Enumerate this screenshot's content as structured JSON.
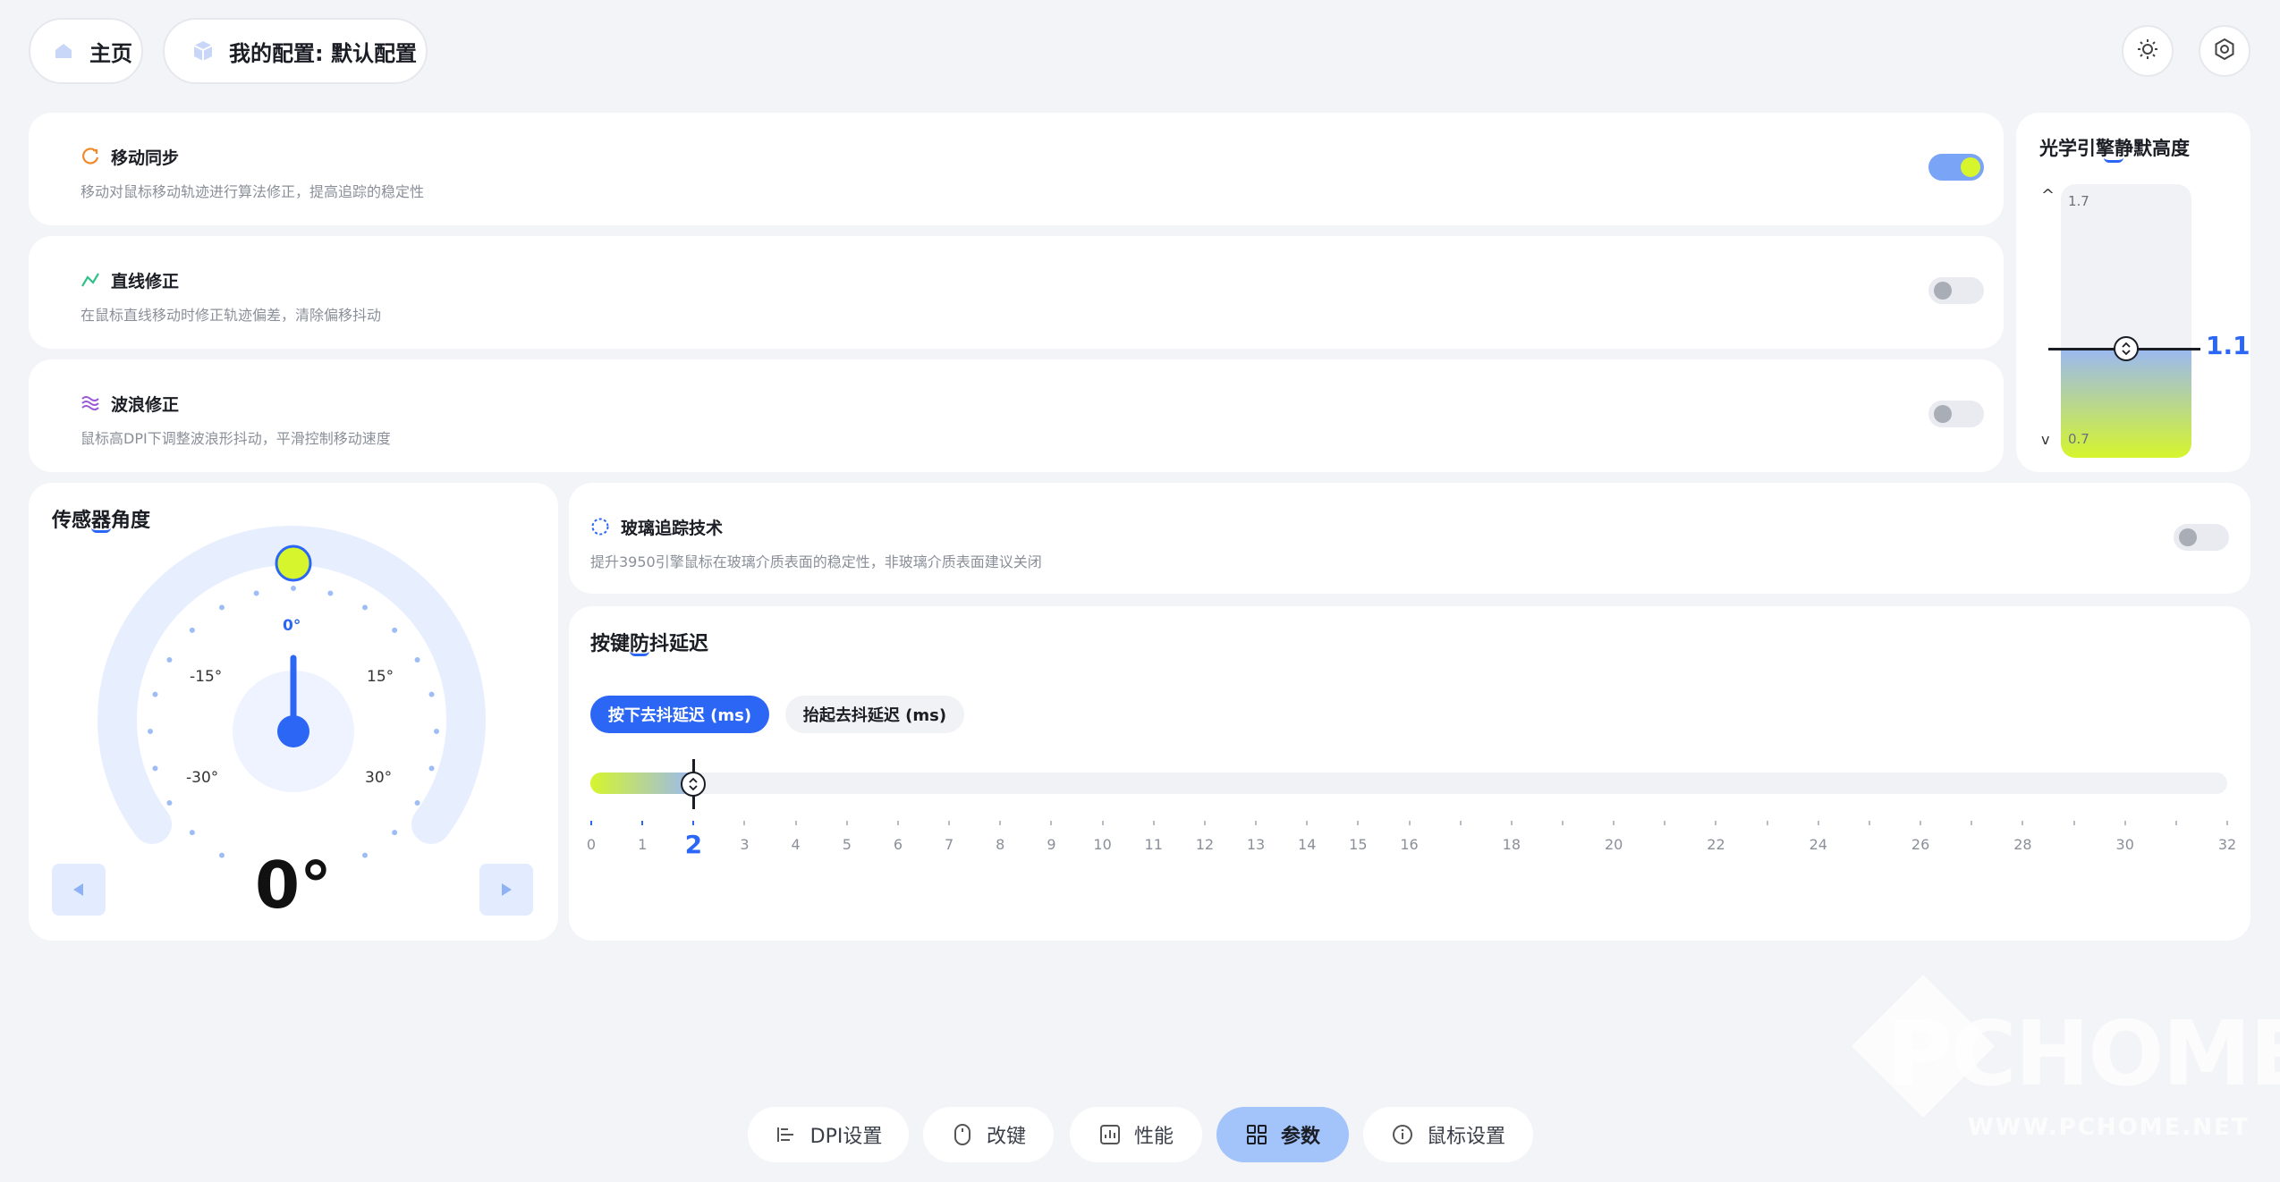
{
  "header": {
    "home_label": "主页",
    "config_label": "我的配置: 默认配置"
  },
  "toggles": [
    {
      "title": "移动同步",
      "desc": "移动对鼠标移动轨迹进行算法修正，提高追踪的稳定性",
      "on": true,
      "icon": "sync-icon"
    },
    {
      "title": "直线修正",
      "desc": "在鼠标直线移动时修正轨迹偏差，清除偏移抖动",
      "on": false,
      "icon": "line-icon"
    },
    {
      "title": "波浪修正",
      "desc": "鼠标高DPI下调整波浪形抖动，平滑控制移动速度",
      "on": false,
      "icon": "wave-icon"
    }
  ],
  "lod": {
    "title": "光学引擎静默高度",
    "max": "1.7",
    "min": "0.7",
    "value": "1.1",
    "value_num": 1.1,
    "up_label": "^",
    "down_label": "v"
  },
  "sensor": {
    "title": "传感器角度",
    "ticks": [
      {
        "label": "0°",
        "angle": 0
      },
      {
        "label": "-15°",
        "angle": -45
      },
      {
        "label": "15°",
        "angle": 45
      },
      {
        "label": "-30°",
        "angle": -90
      },
      {
        "label": "30°",
        "angle": 90
      }
    ],
    "value": "0°"
  },
  "glass": {
    "title": "玻璃追踪技术",
    "desc": "提升3950引擎鼠标在玻璃介质表面的稳定性，非玻璃介质表面建议关闭",
    "on": false
  },
  "debounce": {
    "title": "按键防抖延迟",
    "tab_press": "按下去抖延迟 (ms)",
    "tab_release": "抬起去抖延迟 (ms)",
    "value": 2,
    "value_label": "2",
    "ticks": [
      0,
      1,
      2,
      3,
      4,
      5,
      6,
      7,
      8,
      9,
      10,
      11,
      12,
      13,
      14,
      15,
      16,
      18,
      20,
      22,
      24,
      26,
      28,
      30,
      32
    ],
    "tick_labels": [
      "0",
      "1",
      "2",
      "3",
      "4",
      "5",
      "6",
      "7",
      "8",
      "9",
      "10",
      "11",
      "12",
      "13",
      "14",
      "15",
      "16",
      "18",
      "20",
      "22",
      "24",
      "26",
      "28",
      "30",
      "32"
    ]
  },
  "tabs": [
    {
      "label": "DPI设置",
      "icon": "dpi-icon",
      "active": false
    },
    {
      "label": "改键",
      "icon": "mouse-icon",
      "active": false
    },
    {
      "label": "性能",
      "icon": "performance-icon",
      "active": false
    },
    {
      "label": "参数",
      "icon": "params-icon",
      "active": true
    },
    {
      "label": "鼠标设置",
      "icon": "info-icon",
      "active": false
    }
  ],
  "watermark": {
    "main": "PCHOME",
    "sub": "WWW.PCHOME.NET"
  },
  "colors": {
    "accent": "#2b66f5",
    "lime": "#d6f52d",
    "light_blue": "#a3c3fb"
  }
}
